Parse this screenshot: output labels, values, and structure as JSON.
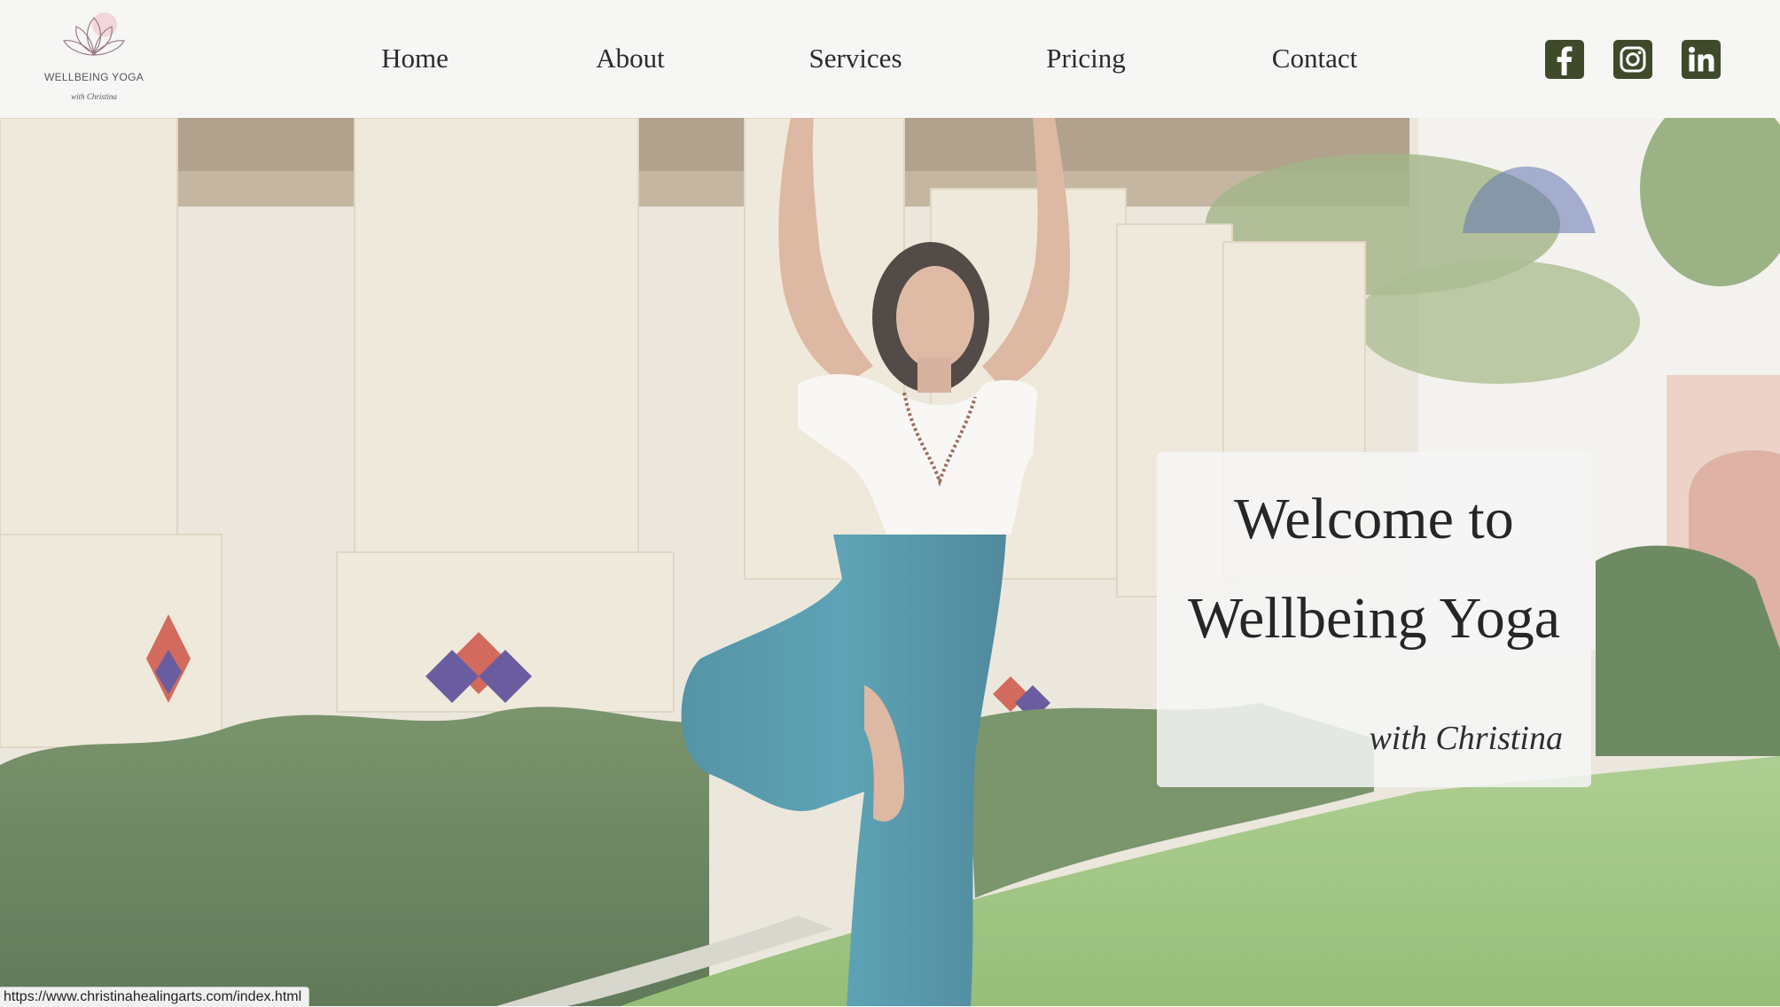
{
  "brand": {
    "name": "WELLBEING YOGA",
    "tagline": "with Christina",
    "logo_icon": "lotus-icon"
  },
  "nav": {
    "items": [
      {
        "label": "Home"
      },
      {
        "label": "About"
      },
      {
        "label": "Services"
      },
      {
        "label": "Pricing"
      },
      {
        "label": "Contact"
      }
    ]
  },
  "social": [
    {
      "icon": "facebook-icon"
    },
    {
      "icon": "instagram-icon"
    },
    {
      "icon": "linkedin-icon"
    }
  ],
  "hero": {
    "line1": "Welcome to",
    "line2": "Wellbeing Yoga",
    "subtitle": "with Christina"
  },
  "status_bar": {
    "url": "https://www.christinahealingarts.com/index.html"
  },
  "colors": {
    "social_icon_bg": "#3f4a2b",
    "header_bg": "#f6f6f5",
    "nav_text": "#2b2b2b"
  }
}
